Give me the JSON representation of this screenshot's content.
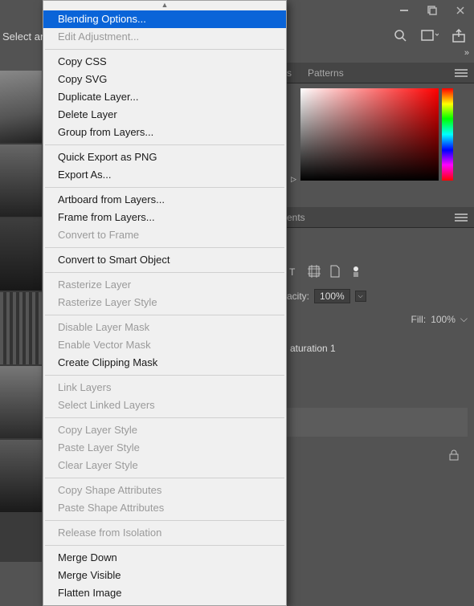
{
  "window": {
    "minimize": "—",
    "maximize": "❐",
    "close": "✕"
  },
  "toolbar": {
    "left_text": "Select and"
  },
  "panels": {
    "swatches_partial": "s",
    "patterns": "Patterns",
    "adjustments_partial": "ents"
  },
  "layers": {
    "opacity_label": "acity:",
    "opacity_value": "100%",
    "fill_label": "Fill:",
    "fill_value": "100%",
    "item1": "aturation 1"
  },
  "context_menu": {
    "items": [
      {
        "label": "Blending Options...",
        "enabled": true,
        "highlight": true
      },
      {
        "label": "Edit Adjustment...",
        "enabled": false
      },
      {
        "sep": true
      },
      {
        "label": "Copy CSS",
        "enabled": true
      },
      {
        "label": "Copy SVG",
        "enabled": true
      },
      {
        "label": "Duplicate Layer...",
        "enabled": true
      },
      {
        "label": "Delete Layer",
        "enabled": true
      },
      {
        "label": "Group from Layers...",
        "enabled": true
      },
      {
        "sep": true
      },
      {
        "label": "Quick Export as PNG",
        "enabled": true
      },
      {
        "label": "Export As...",
        "enabled": true
      },
      {
        "sep": true
      },
      {
        "label": "Artboard from Layers...",
        "enabled": true
      },
      {
        "label": "Frame from Layers...",
        "enabled": true
      },
      {
        "label": "Convert to Frame",
        "enabled": false
      },
      {
        "sep": true
      },
      {
        "label": "Convert to Smart Object",
        "enabled": true
      },
      {
        "sep": true
      },
      {
        "label": "Rasterize Layer",
        "enabled": false
      },
      {
        "label": "Rasterize Layer Style",
        "enabled": false
      },
      {
        "sep": true
      },
      {
        "label": "Disable Layer Mask",
        "enabled": false
      },
      {
        "label": "Enable Vector Mask",
        "enabled": false
      },
      {
        "label": "Create Clipping Mask",
        "enabled": true
      },
      {
        "sep": true
      },
      {
        "label": "Link Layers",
        "enabled": false
      },
      {
        "label": "Select Linked Layers",
        "enabled": false
      },
      {
        "sep": true
      },
      {
        "label": "Copy Layer Style",
        "enabled": false
      },
      {
        "label": "Paste Layer Style",
        "enabled": false
      },
      {
        "label": "Clear Layer Style",
        "enabled": false
      },
      {
        "sep": true
      },
      {
        "label": "Copy Shape Attributes",
        "enabled": false
      },
      {
        "label": "Paste Shape Attributes",
        "enabled": false
      },
      {
        "sep": true
      },
      {
        "label": "Release from Isolation",
        "enabled": false
      },
      {
        "sep": true
      },
      {
        "label": "Merge Down",
        "enabled": true
      },
      {
        "label": "Merge Visible",
        "enabled": true
      },
      {
        "label": "Flatten Image",
        "enabled": true
      }
    ]
  }
}
